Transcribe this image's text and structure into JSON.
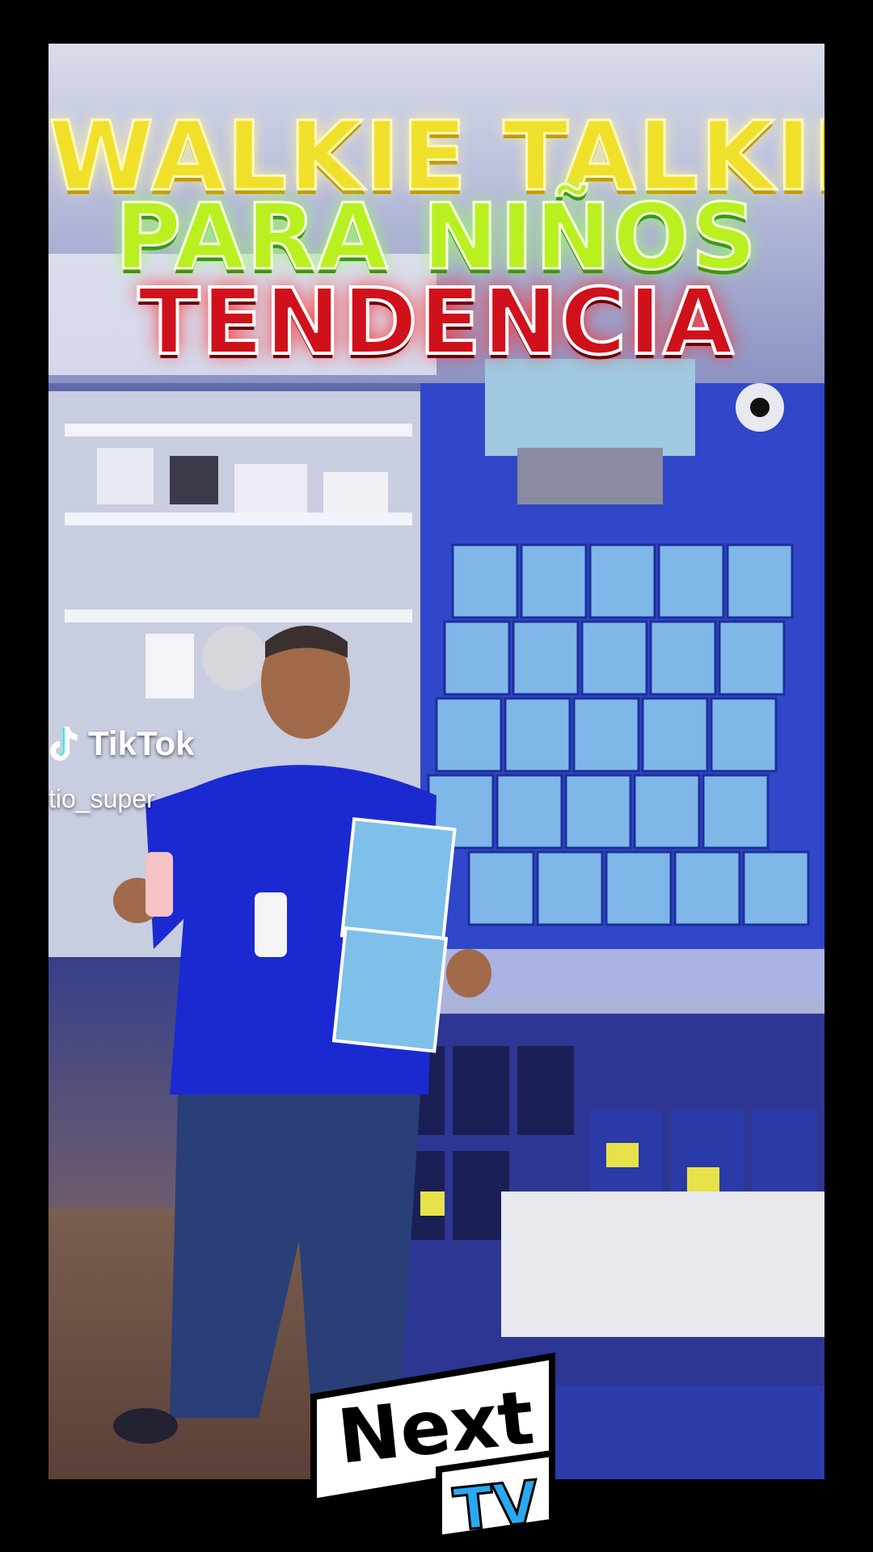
{
  "overlay": {
    "line1": "WALKIE TALKIE",
    "line2": "PARA NIÑOS",
    "line3": "TENDENCIA"
  },
  "watermark": {
    "app": "TikTok",
    "handle": "tio_super",
    "icon": "tiktok-note-icon"
  },
  "logo": {
    "line1": "Next",
    "line2": "TV"
  },
  "colors": {
    "line1": "#f1e02a",
    "line2": "#b8f020",
    "line3": "#d0101a",
    "logo_accent": "#2aa9f0"
  }
}
